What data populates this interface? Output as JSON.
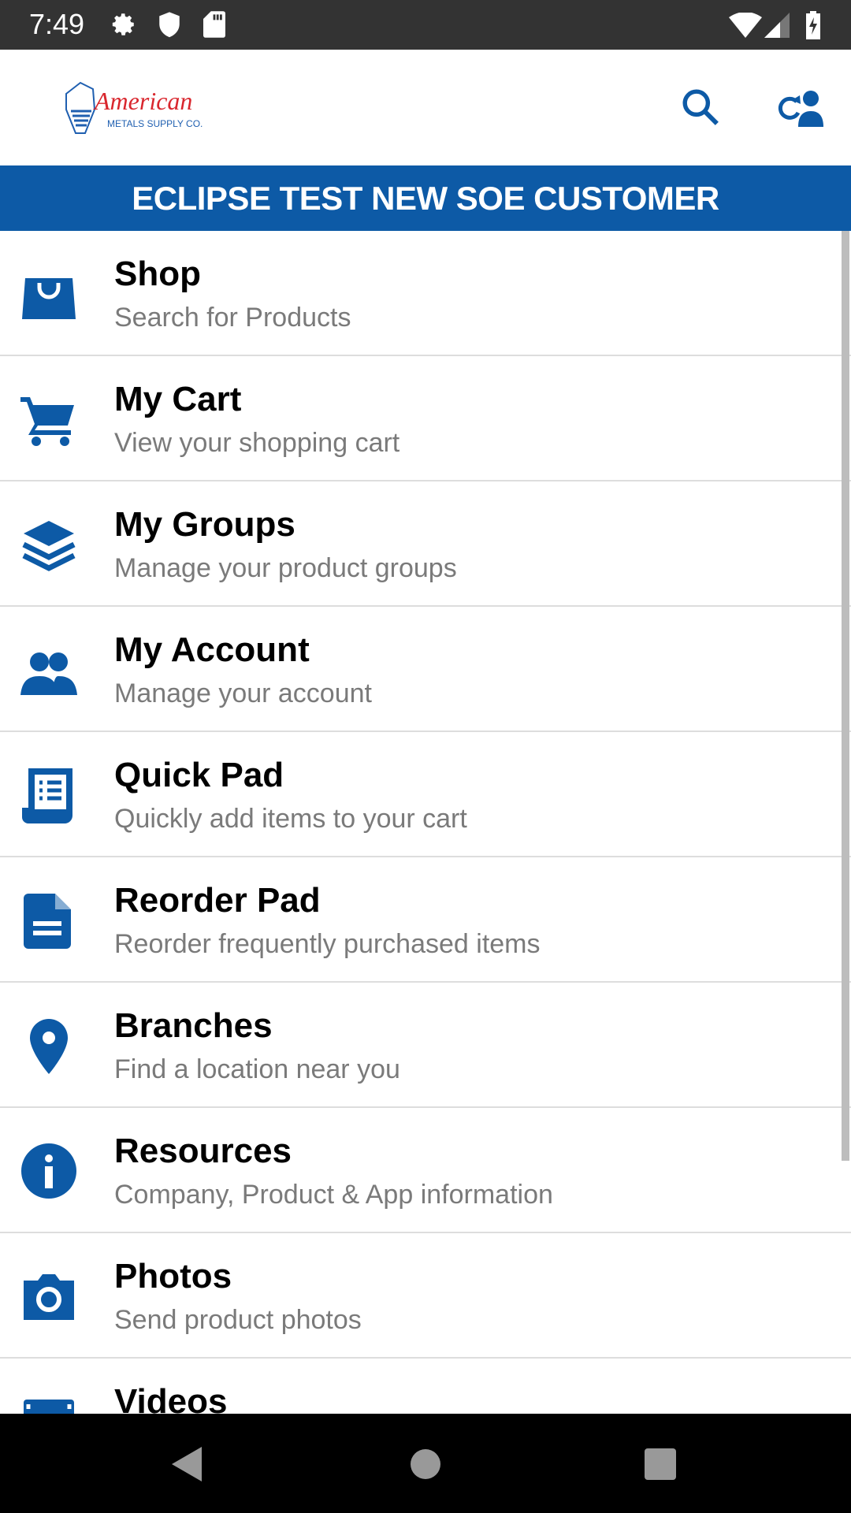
{
  "status_bar": {
    "time": "7:49",
    "icons": [
      "gear-icon",
      "shield-icon",
      "sd-card-icon",
      "wifi-icon",
      "signal-icon",
      "battery-charging-icon"
    ]
  },
  "header": {
    "logo_text": "American",
    "logo_subtext": "METALS SUPPLY CO.",
    "actions": [
      "search-icon",
      "switch-account-icon"
    ]
  },
  "banner": {
    "title": "ECLIPSE TEST NEW SOE CUSTOMER"
  },
  "brand_color": "#0d5aa6",
  "menu": [
    {
      "title": "Shop",
      "subtitle": "Search for Products",
      "icon": "shopping-bag-icon"
    },
    {
      "title": "My Cart",
      "subtitle": "View your shopping cart",
      "icon": "cart-icon"
    },
    {
      "title": "My Groups",
      "subtitle": "Manage your product groups",
      "icon": "layers-icon"
    },
    {
      "title": "My Account",
      "subtitle": "Manage your account",
      "icon": "users-icon"
    },
    {
      "title": "Quick Pad",
      "subtitle": "Quickly add items to your cart",
      "icon": "list-document-icon"
    },
    {
      "title": "Reorder Pad",
      "subtitle": "Reorder frequently purchased items",
      "icon": "file-icon"
    },
    {
      "title": "Branches",
      "subtitle": "Find a location near you",
      "icon": "map-pin-icon"
    },
    {
      "title": "Resources",
      "subtitle": "Company, Product & App information",
      "icon": "info-icon"
    },
    {
      "title": "Photos",
      "subtitle": "Send product photos",
      "icon": "camera-icon"
    },
    {
      "title": "Videos",
      "subtitle": "",
      "icon": "film-icon"
    }
  ]
}
